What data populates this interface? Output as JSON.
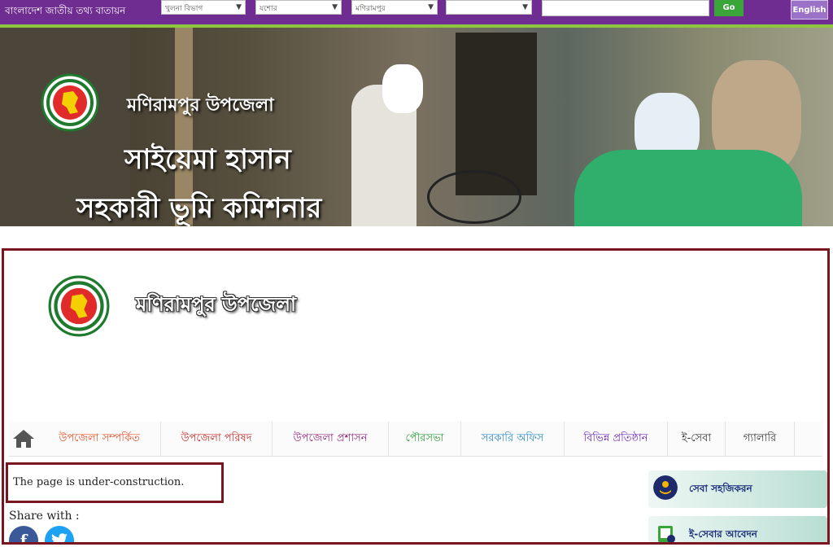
{
  "topbar": {
    "portal_title": "বাংলাদেশ জাতীয় তথ্য বাতায়ন",
    "selects": [
      {
        "value": "খুলনা বিভাগ"
      },
      {
        "value": "যশোর"
      },
      {
        "value": "মণিরামপুর"
      },
      {
        "value": ""
      }
    ],
    "search_value": "",
    "go_label": "Go",
    "language_label": "English"
  },
  "banner": {
    "line1": "মণিরামপুর উপজেলা",
    "line2": "সাইয়েমা হাসান",
    "line3": "সহকারী ভূমি কমিশনার"
  },
  "site": {
    "title": "মণিরামপুর উপজেলা"
  },
  "nav": {
    "items": [
      {
        "label": "উপজেলা সম্পর্কিত",
        "color": "#e2502b"
      },
      {
        "label": "উপজেলা পরিষদ",
        "color": "#c22a2a"
      },
      {
        "label": "উপজেলা প্রশাসন",
        "color": "#8e2a7a"
      },
      {
        "label": "পৌরসভা",
        "color": "#2e9a3b"
      },
      {
        "label": "সরকারি অফিস",
        "color": "#2a8abf"
      },
      {
        "label": "বিভিন্ন প্রতিষ্ঠান",
        "color": "#6a2ab0"
      },
      {
        "label": "ই-সেবা",
        "color": "#333333"
      },
      {
        "label": "গ্যালারি",
        "color": "#333333"
      }
    ]
  },
  "content": {
    "notice": "The page is under-construction.",
    "share_label": "Share with :"
  },
  "sidebar": {
    "cards": [
      {
        "label": "সেবা সহজিকরন"
      },
      {
        "label": "ই-সেবার আবেদন"
      }
    ]
  },
  "colors": {
    "topbar": "#6f2c91",
    "topbar_border": "#8dc63f",
    "frame_border": "#7a1620",
    "go_button": "#3aa63a",
    "language_button": "#9b70c7"
  }
}
